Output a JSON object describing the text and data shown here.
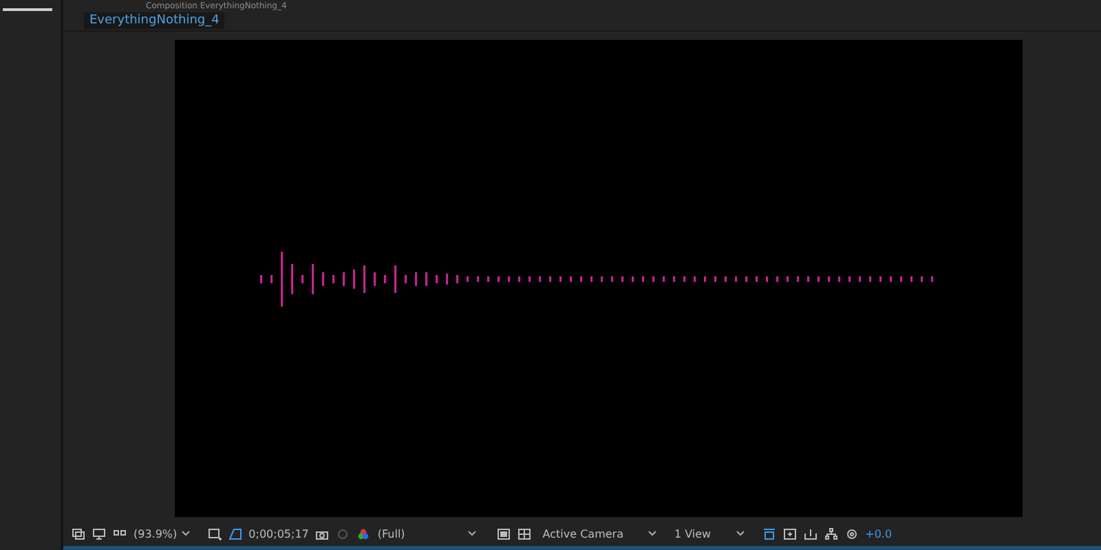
{
  "panel_header": {
    "title": "Composition EverythingNothing_4"
  },
  "tabs": [
    {
      "label": "EverythingNothing_4",
      "selected": true
    }
  ],
  "toolbar": {
    "zoom": "(93.9%)",
    "timecode": "0;00;05;17",
    "resolution": "(Full)",
    "camera": "Active Camera",
    "views": "1 View",
    "exposure": "+0.0"
  }
}
